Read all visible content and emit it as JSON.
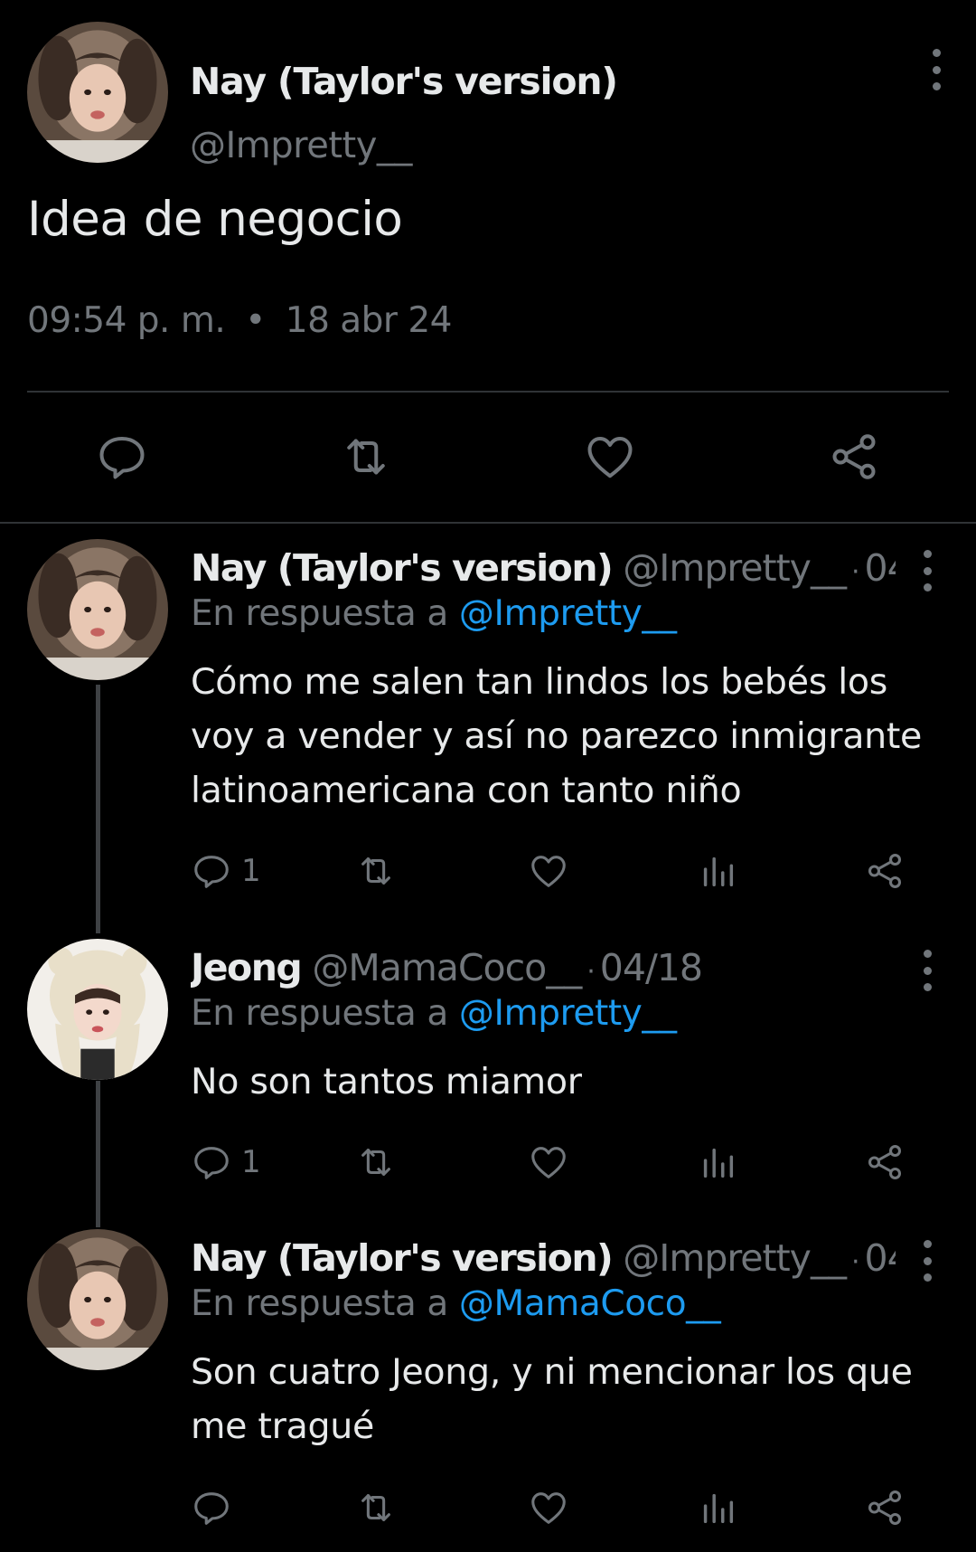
{
  "main_tweet": {
    "author_name": "Nay (Taylor's version)",
    "author_handle": "@Impretty__",
    "text": "Idea de negocio",
    "time": "09:54 p. m.",
    "separator": "•",
    "date": "18 abr 24",
    "actions": [
      "reply-icon",
      "retweet-icon",
      "like-icon",
      "share-icon"
    ]
  },
  "replies": [
    {
      "author_name": "Nay (Taylor's version)",
      "author_handle": "@Impretty__",
      "separator": "·",
      "date": "04...",
      "reply_prefix": "En respuesta a",
      "reply_to": "@Impretty__",
      "text_lines": [
        "Cómo me salen tan lindos los bebés los",
        "voy a vender y así no parezco inmigrante",
        "latinoamericana con tanto niño"
      ],
      "reply_count": "1"
    },
    {
      "author_name": "Jeong",
      "author_handle": "@MamaCoco__",
      "separator": "·",
      "date": "04/18",
      "reply_prefix": "En respuesta a",
      "reply_to": "@Impretty__",
      "text_lines": [
        "No son tantos miamor"
      ],
      "reply_count": "1"
    },
    {
      "author_name": "Nay (Taylor's version)",
      "author_handle": "@Impretty__",
      "separator": "·",
      "date": "04...",
      "reply_prefix": "En respuesta a",
      "reply_to": "@MamaCoco__",
      "text_lines": [
        "Son cuatro Jeong, y ni mencionar los que",
        "me tragué"
      ],
      "reply_count": ""
    }
  ],
  "colors": {
    "background": "#000000",
    "text_primary": "#e7e9ea",
    "text_secondary": "#71767b",
    "accent": "#1d9bf0",
    "divider": "#2f3336"
  }
}
